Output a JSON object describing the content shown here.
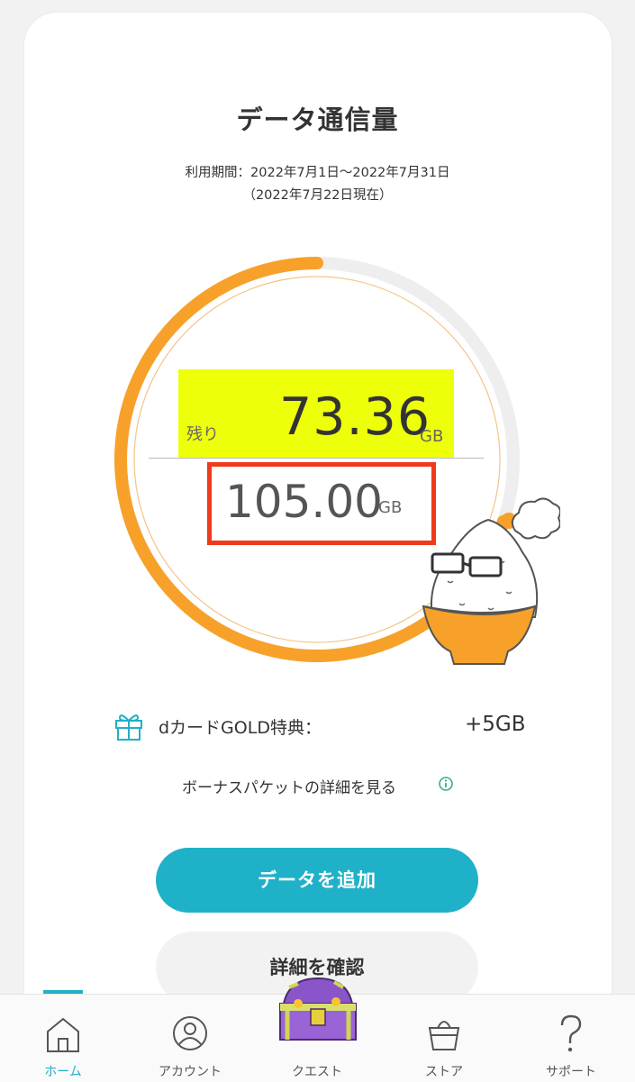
{
  "header": {
    "title": "データ通信量",
    "period": "利用期間：2022年7月1日〜2022年7月31日",
    "as_of": "（2022年7月22日現在）"
  },
  "usage": {
    "remaining_label": "残り",
    "remaining_value": "73.36",
    "remaining_unit": "GB",
    "total_value": "105.00",
    "total_unit": "GB",
    "remaining_fraction": 0.699,
    "colors": {
      "arc": "#f7a12a",
      "track": "#eeeeee",
      "highlight": "#eeff0a",
      "box": "#ef3a1b"
    }
  },
  "benefit": {
    "icon": "gift-icon",
    "label": "dカードGOLD特典：",
    "value": "+5GB"
  },
  "bonus": {
    "link_label": "ボーナスパケットの詳細を見る",
    "icon": "info-icon"
  },
  "buttons": {
    "add_data": "データを追加",
    "details": "詳細を確認"
  },
  "accent_color": "#1fb1c8",
  "tabs": [
    {
      "label": "ホーム",
      "icon": "home-icon",
      "active": true
    },
    {
      "label": "アカウント",
      "icon": "account-icon",
      "active": false
    },
    {
      "label": "クエスト",
      "icon": "treasure-chest-icon",
      "active": false
    },
    {
      "label": "ストア",
      "icon": "basket-icon",
      "active": false
    },
    {
      "label": "サポート",
      "icon": "question-icon",
      "active": false
    }
  ]
}
